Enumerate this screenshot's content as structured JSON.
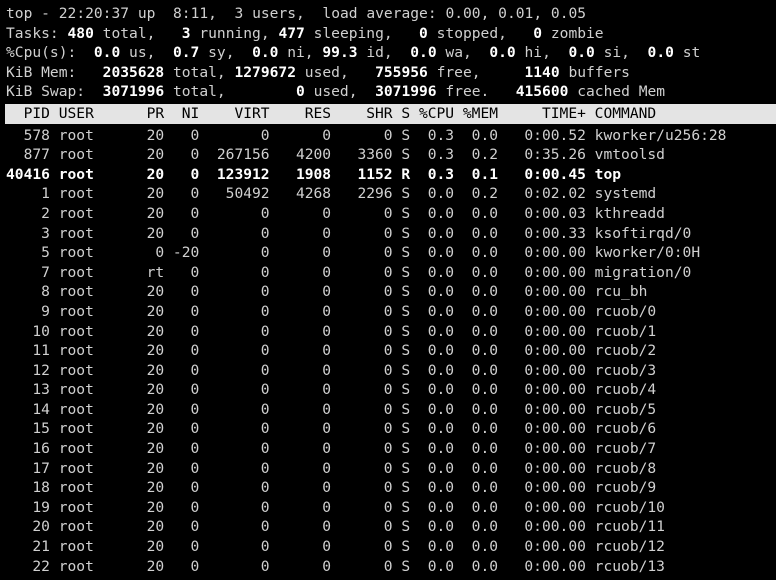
{
  "terminal": {
    "app": "top",
    "colors": {
      "background": "#000000",
      "foreground": "#d0d0d0",
      "bold_foreground": "#ffffff",
      "header_bar_background": "#e4e4e4",
      "header_bar_foreground": "#000000"
    }
  },
  "summary": {
    "uptime_line": {
      "program": "top",
      "dash": "-",
      "time": "22:20:37",
      "up_label": "up",
      "uptime": "8:11,",
      "users_count": "3",
      "users_label": "users,",
      "load_label": "load average:",
      "load_1min": "0.00,",
      "load_5min": "0.01,",
      "load_15min": "0.05",
      "full": "top - 22:20:37 up  8:11,  3 users,  load average: 0.00, 0.01, 0.05"
    },
    "tasks_line": {
      "label": "Tasks:",
      "total": "480",
      "total_label": "total,",
      "running": "3",
      "running_label": "running,",
      "sleeping": "477",
      "sleeping_label": "sleeping,",
      "stopped": "0",
      "stopped_label": "stopped,",
      "zombie": "0",
      "zombie_label": "zombie"
    },
    "cpu_line": {
      "label": "%Cpu(s):",
      "us": "0.0",
      "us_label": "us,",
      "sy": "0.7",
      "sy_label": "sy,",
      "ni": "0.0",
      "ni_label": "ni,",
      "id": "99.3",
      "id_label": "id,",
      "wa": "0.0",
      "wa_label": "wa,",
      "hi": "0.0",
      "hi_label": "hi,",
      "si": "0.0",
      "si_label": "si,",
      "st": "0.0",
      "st_label": "st"
    },
    "mem_line": {
      "label": "KiB Mem:",
      "total": "2035628",
      "total_label": "total,",
      "used": "1279672",
      "used_label": "used,",
      "free": "755956",
      "free_label": "free,",
      "buffers": "1140",
      "buffers_label": "buffers"
    },
    "swap_line": {
      "label": "KiB Swap:",
      "total": "3071996",
      "total_label": "total,",
      "used": "0",
      "used_label": "used,",
      "free": "3071996",
      "free_label": "free.",
      "cached": "415600",
      "cached_label": "cached Mem"
    }
  },
  "table": {
    "columns": [
      "PID",
      "USER",
      "PR",
      "NI",
      "VIRT",
      "RES",
      "SHR",
      "S",
      "%CPU",
      "%MEM",
      "TIME+",
      "COMMAND"
    ],
    "header_text": "  PID USER      PR  NI    VIRT    RES    SHR S %CPU %MEM     TIME+ COMMAND                     ",
    "rows": [
      {
        "pid": "578",
        "user": "root",
        "pr": "20",
        "ni": "0",
        "virt": "0",
        "res": "0",
        "shr": "0",
        "s": "S",
        "cpu": "0.3",
        "mem": "0.0",
        "time": "0:00.52",
        "command": "kworker/u256:28",
        "bold": false
      },
      {
        "pid": "877",
        "user": "root",
        "pr": "20",
        "ni": "0",
        "virt": "267156",
        "res": "4200",
        "shr": "3360",
        "s": "S",
        "cpu": "0.3",
        "mem": "0.2",
        "time": "0:35.26",
        "command": "vmtoolsd",
        "bold": false
      },
      {
        "pid": "40416",
        "user": "root",
        "pr": "20",
        "ni": "0",
        "virt": "123912",
        "res": "1908",
        "shr": "1152",
        "s": "R",
        "cpu": "0.3",
        "mem": "0.1",
        "time": "0:00.45",
        "command": "top",
        "bold": true
      },
      {
        "pid": "1",
        "user": "root",
        "pr": "20",
        "ni": "0",
        "virt": "50492",
        "res": "4268",
        "shr": "2296",
        "s": "S",
        "cpu": "0.0",
        "mem": "0.2",
        "time": "0:02.02",
        "command": "systemd",
        "bold": false
      },
      {
        "pid": "2",
        "user": "root",
        "pr": "20",
        "ni": "0",
        "virt": "0",
        "res": "0",
        "shr": "0",
        "s": "S",
        "cpu": "0.0",
        "mem": "0.0",
        "time": "0:00.03",
        "command": "kthreadd",
        "bold": false
      },
      {
        "pid": "3",
        "user": "root",
        "pr": "20",
        "ni": "0",
        "virt": "0",
        "res": "0",
        "shr": "0",
        "s": "S",
        "cpu": "0.0",
        "mem": "0.0",
        "time": "0:00.33",
        "command": "ksoftirqd/0",
        "bold": false
      },
      {
        "pid": "5",
        "user": "root",
        "pr": "0",
        "ni": "-20",
        "virt": "0",
        "res": "0",
        "shr": "0",
        "s": "S",
        "cpu": "0.0",
        "mem": "0.0",
        "time": "0:00.00",
        "command": "kworker/0:0H",
        "bold": false
      },
      {
        "pid": "7",
        "user": "root",
        "pr": "rt",
        "ni": "0",
        "virt": "0",
        "res": "0",
        "shr": "0",
        "s": "S",
        "cpu": "0.0",
        "mem": "0.0",
        "time": "0:00.00",
        "command": "migration/0",
        "bold": false
      },
      {
        "pid": "8",
        "user": "root",
        "pr": "20",
        "ni": "0",
        "virt": "0",
        "res": "0",
        "shr": "0",
        "s": "S",
        "cpu": "0.0",
        "mem": "0.0",
        "time": "0:00.00",
        "command": "rcu_bh",
        "bold": false
      },
      {
        "pid": "9",
        "user": "root",
        "pr": "20",
        "ni": "0",
        "virt": "0",
        "res": "0",
        "shr": "0",
        "s": "S",
        "cpu": "0.0",
        "mem": "0.0",
        "time": "0:00.00",
        "command": "rcuob/0",
        "bold": false
      },
      {
        "pid": "10",
        "user": "root",
        "pr": "20",
        "ni": "0",
        "virt": "0",
        "res": "0",
        "shr": "0",
        "s": "S",
        "cpu": "0.0",
        "mem": "0.0",
        "time": "0:00.00",
        "command": "rcuob/1",
        "bold": false
      },
      {
        "pid": "11",
        "user": "root",
        "pr": "20",
        "ni": "0",
        "virt": "0",
        "res": "0",
        "shr": "0",
        "s": "S",
        "cpu": "0.0",
        "mem": "0.0",
        "time": "0:00.00",
        "command": "rcuob/2",
        "bold": false
      },
      {
        "pid": "12",
        "user": "root",
        "pr": "20",
        "ni": "0",
        "virt": "0",
        "res": "0",
        "shr": "0",
        "s": "S",
        "cpu": "0.0",
        "mem": "0.0",
        "time": "0:00.00",
        "command": "rcuob/3",
        "bold": false
      },
      {
        "pid": "13",
        "user": "root",
        "pr": "20",
        "ni": "0",
        "virt": "0",
        "res": "0",
        "shr": "0",
        "s": "S",
        "cpu": "0.0",
        "mem": "0.0",
        "time": "0:00.00",
        "command": "rcuob/4",
        "bold": false
      },
      {
        "pid": "14",
        "user": "root",
        "pr": "20",
        "ni": "0",
        "virt": "0",
        "res": "0",
        "shr": "0",
        "s": "S",
        "cpu": "0.0",
        "mem": "0.0",
        "time": "0:00.00",
        "command": "rcuob/5",
        "bold": false
      },
      {
        "pid": "15",
        "user": "root",
        "pr": "20",
        "ni": "0",
        "virt": "0",
        "res": "0",
        "shr": "0",
        "s": "S",
        "cpu": "0.0",
        "mem": "0.0",
        "time": "0:00.00",
        "command": "rcuob/6",
        "bold": false
      },
      {
        "pid": "16",
        "user": "root",
        "pr": "20",
        "ni": "0",
        "virt": "0",
        "res": "0",
        "shr": "0",
        "s": "S",
        "cpu": "0.0",
        "mem": "0.0",
        "time": "0:00.00",
        "command": "rcuob/7",
        "bold": false
      },
      {
        "pid": "17",
        "user": "root",
        "pr": "20",
        "ni": "0",
        "virt": "0",
        "res": "0",
        "shr": "0",
        "s": "S",
        "cpu": "0.0",
        "mem": "0.0",
        "time": "0:00.00",
        "command": "rcuob/8",
        "bold": false
      },
      {
        "pid": "18",
        "user": "root",
        "pr": "20",
        "ni": "0",
        "virt": "0",
        "res": "0",
        "shr": "0",
        "s": "S",
        "cpu": "0.0",
        "mem": "0.0",
        "time": "0:00.00",
        "command": "rcuob/9",
        "bold": false
      },
      {
        "pid": "19",
        "user": "root",
        "pr": "20",
        "ni": "0",
        "virt": "0",
        "res": "0",
        "shr": "0",
        "s": "S",
        "cpu": "0.0",
        "mem": "0.0",
        "time": "0:00.00",
        "command": "rcuob/10",
        "bold": false
      },
      {
        "pid": "20",
        "user": "root",
        "pr": "20",
        "ni": "0",
        "virt": "0",
        "res": "0",
        "shr": "0",
        "s": "S",
        "cpu": "0.0",
        "mem": "0.0",
        "time": "0:00.00",
        "command": "rcuob/11",
        "bold": false
      },
      {
        "pid": "21",
        "user": "root",
        "pr": "20",
        "ni": "0",
        "virt": "0",
        "res": "0",
        "shr": "0",
        "s": "S",
        "cpu": "0.0",
        "mem": "0.0",
        "time": "0:00.00",
        "command": "rcuob/12",
        "bold": false
      },
      {
        "pid": "22",
        "user": "root",
        "pr": "20",
        "ni": "0",
        "virt": "0",
        "res": "0",
        "shr": "0",
        "s": "S",
        "cpu": "0.0",
        "mem": "0.0",
        "time": "0:00.00",
        "command": "rcuob/13",
        "bold": false
      }
    ]
  }
}
